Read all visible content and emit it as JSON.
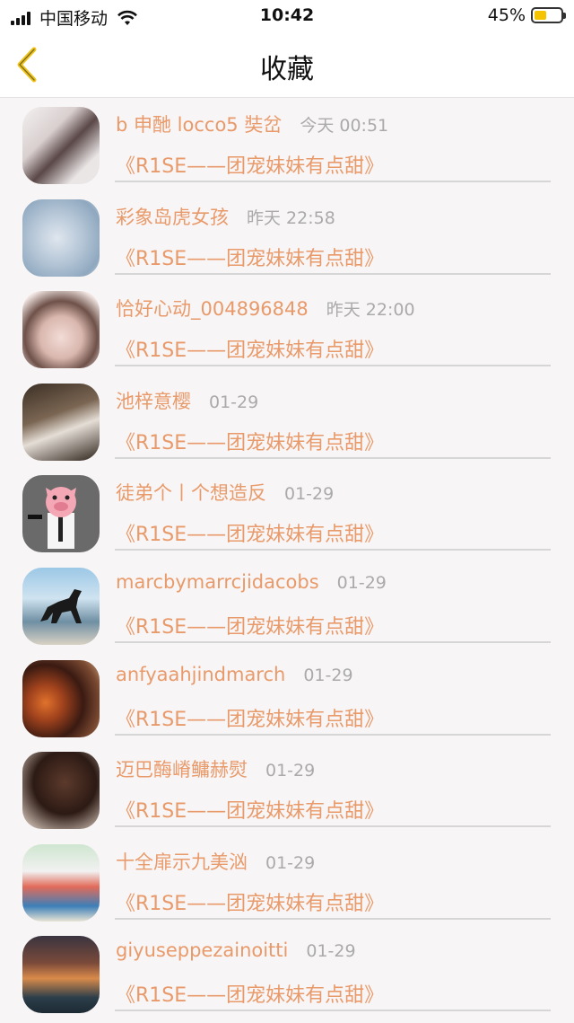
{
  "status": {
    "carrier": "中国移动",
    "time": "10:42",
    "battery": "45%"
  },
  "nav": {
    "title": "收藏",
    "back_icon": "chevron-left-icon",
    "accent": "#f0c419"
  },
  "colors": {
    "name": "#e89a6a",
    "time": "#aaaaaa",
    "background": "#f8f5f6"
  },
  "items": [
    {
      "name": "b 申酏 locco5 奘岔",
      "time": "今天 00:51",
      "title": "《R1SE——团宠妹妹有点甜》"
    },
    {
      "name": "彩象岛虎女孩",
      "time": "昨天 22:58",
      "title": "《R1SE——团宠妹妹有点甜》"
    },
    {
      "name": "恰好心动_004896848",
      "time": "昨天 22:00",
      "title": "《R1SE——团宠妹妹有点甜》"
    },
    {
      "name": "池梓意樱",
      "time": "01-29",
      "title": "《R1SE——团宠妹妹有点甜》"
    },
    {
      "name": "徒弟个丨个想造反",
      "time": "01-29",
      "title": "《R1SE——团宠妹妹有点甜》"
    },
    {
      "name": "marcbymarrcjidacobs",
      "time": "01-29",
      "title": "《R1SE——团宠妹妹有点甜》"
    },
    {
      "name": "anfyaahjindmarch",
      "time": "01-29",
      "title": "《R1SE——团宠妹妹有点甜》"
    },
    {
      "name": "迈巴酶嵴鳙赫熨",
      "time": "01-29",
      "title": "《R1SE——团宠妹妹有点甜》"
    },
    {
      "name": "十全扉示九美汹",
      "time": "01-29",
      "title": "《R1SE——团宠妹妹有点甜》"
    },
    {
      "name": "giyuseppezainoitti",
      "time": "01-29",
      "title": "《R1SE——团宠妹妹有点甜》"
    }
  ]
}
